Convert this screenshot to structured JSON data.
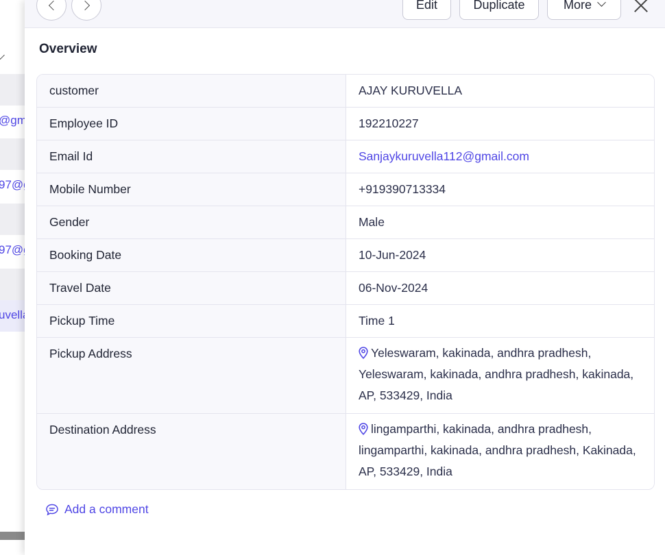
{
  "background_list": {
    "fragments": [
      "@gma",
      "97@g",
      "97@g",
      "uvella"
    ]
  },
  "header": {
    "prev_label": "",
    "next_label": "",
    "edit_label": "Edit",
    "duplicate_label": "Duplicate",
    "more_label": "More"
  },
  "section_title": "Overview",
  "details": {
    "customer": {
      "label": "customer",
      "value": "AJAY KURUVELLA"
    },
    "employee_id": {
      "label": "Employee ID",
      "value": "192210227"
    },
    "email": {
      "label": "Email Id",
      "value": "Sanjaykuruvella112@gmail.com"
    },
    "mobile": {
      "label": "Mobile Number",
      "value": "+919390713334"
    },
    "gender": {
      "label": "Gender",
      "value": "Male"
    },
    "booking_date": {
      "label": "Booking Date",
      "value": "10-Jun-2024"
    },
    "travel_date": {
      "label": "Travel Date",
      "value": "06-Nov-2024"
    },
    "pickup_time": {
      "label": "Pickup Time",
      "value": "Time 1"
    },
    "pickup_address": {
      "label": "Pickup Address",
      "value": "Yeleswaram, kakinada, andhra pradhesh, Yeleswaram, kakinada, andhra pradhesh, kakinada, AP, 533429, India"
    },
    "destination_address": {
      "label": "Destination Address",
      "value": "lingamparthi, kakinada, andhra pradhesh, lingamparthi, kakinada, andhra pradhesh, Kakinada, AP, 533429, India"
    }
  },
  "comment_label": "Add a comment",
  "colors": {
    "accent": "#4f46e5",
    "label_bg": "#f8f8fc",
    "border": "#e4e4ee",
    "header_bg": "#f6f6fb"
  },
  "icons": [
    "chevron-left-icon",
    "chevron-right-icon",
    "chevron-down-icon",
    "close-icon",
    "location-pin-icon",
    "comment-icon"
  ]
}
